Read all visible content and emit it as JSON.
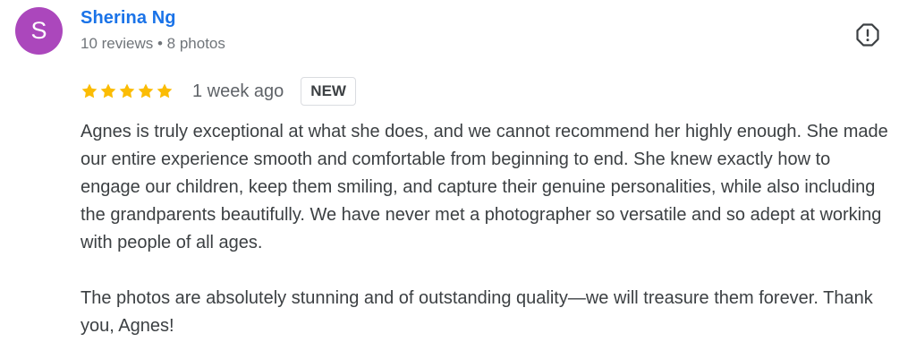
{
  "review": {
    "author": {
      "initial": "S",
      "name": "Sherina Ng",
      "meta": "10 reviews • 8 photos",
      "avatar_color": "#ab47bc",
      "name_color": "#1a73e8"
    },
    "flag_icon": "report-flag-icon",
    "rating": {
      "stars": 5,
      "max": 5,
      "star_color": "#fbbc04"
    },
    "date": "1 week ago",
    "badge": "NEW",
    "paragraphs": [
      "Agnes is truly exceptional at what she does, and we cannot recommend her highly enough. She made our entire experience smooth and comfortable from beginning to end. She knew exactly how to engage our children, keep them smiling, and capture their genuine personalities, while also including the grandparents beautifully. We have never met a photographer so versatile and so adept at working with people of all ages.",
      "The photos are absolutely stunning and of outstanding quality—we will treasure them forever. Thank you, Agnes!"
    ]
  }
}
